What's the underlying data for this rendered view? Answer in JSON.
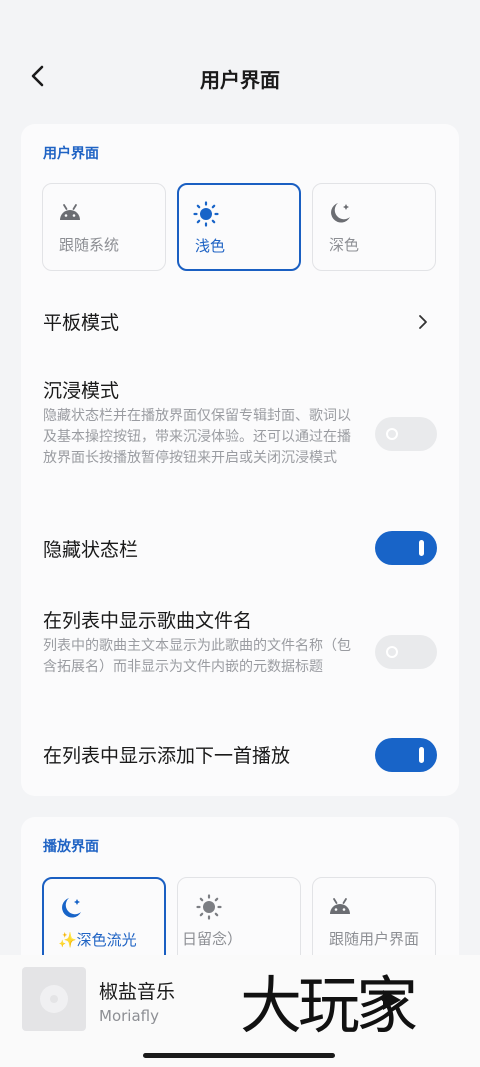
{
  "header": {
    "title": "用户界面"
  },
  "ui_section": {
    "title": "用户界面",
    "theme_options": [
      {
        "label": "跟随系统",
        "icon": "android-icon"
      },
      {
        "label": "浅色",
        "icon": "sun-icon",
        "selected": true
      },
      {
        "label": "深色",
        "icon": "moon-icon"
      }
    ],
    "tablet_mode": {
      "title": "平板模式"
    },
    "immersive": {
      "title": "沉浸模式",
      "desc": "隐藏状态栏并在播放界面仅保留专辑封面、歌词以及基本操控按钮，带来沉浸体验。还可以通过在播放界面长按播放暂停按钮来开启或关闭沉浸模式",
      "enabled": false
    },
    "hide_statusbar": {
      "title": "隐藏状态栏",
      "enabled": true
    },
    "show_filename": {
      "title": "在列表中显示歌曲文件名",
      "desc": "列表中的歌曲主文本显示为此歌曲的文件名称（包含拓展名）而非显示为文件内嵌的元数据标题",
      "enabled": false
    },
    "show_add_next": {
      "title": "在列表中显示添加下一首播放",
      "enabled": true
    }
  },
  "player_section": {
    "title": "播放界面",
    "options": [
      {
        "label": "✨深色流光",
        "icon": "moon-icon",
        "selected": true
      },
      {
        "label": "日留念）",
        "icon": "sun-icon"
      },
      {
        "label": "跟随用户界面",
        "icon": "android-icon"
      }
    ]
  },
  "mini_player": {
    "title": "椒盐音乐",
    "subtitle": "Moriafly"
  },
  "watermark": {
    "text": "大玩家"
  },
  "colors": {
    "accent": "#1864c8",
    "accent_text": "#1f63c4",
    "background": "#f3f4f6"
  }
}
